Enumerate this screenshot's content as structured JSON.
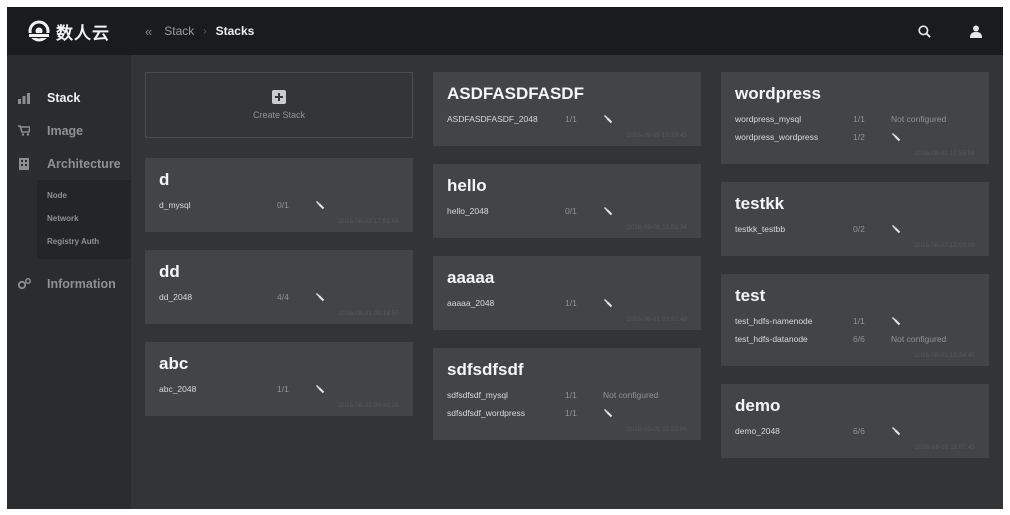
{
  "app": {
    "logo_text": "数人云"
  },
  "breadcrumb": {
    "back": "«",
    "items": [
      "Stack",
      "Stacks"
    ]
  },
  "sidebar": {
    "items": [
      {
        "label": "Stack",
        "icon": "chart-icon"
      },
      {
        "label": "Image",
        "icon": "cart-icon"
      },
      {
        "label": "Architecture",
        "icon": "building-icon"
      }
    ],
    "sub_items": [
      "Node",
      "Network",
      "Registry Auth"
    ],
    "info": {
      "label": "Information",
      "icon": "gears-icon"
    }
  },
  "create_stack": {
    "label": "Create Stack"
  },
  "columns": [
    [
      {
        "title": "d",
        "services": [
          {
            "name": "d_mysql",
            "count": "0/1",
            "status": ""
          }
        ],
        "timestamp": "2016-08-02 17:51:56"
      },
      {
        "title": "dd",
        "services": [
          {
            "name": "dd_2048",
            "count": "4/4",
            "status": ""
          }
        ],
        "timestamp": "2016-08-31 09:18:55"
      },
      {
        "title": "abc",
        "services": [
          {
            "name": "abc_2048",
            "count": "1/1",
            "status": ""
          }
        ],
        "timestamp": "2016-08-31 09:40:26"
      }
    ],
    [
      {
        "title": "ASDFASDFASDF",
        "services": [
          {
            "name": "ASDFASDFASDF_2048",
            "count": "1/1",
            "status": ""
          }
        ],
        "timestamp": "2016-09-05 13:23:45"
      },
      {
        "title": "hello",
        "services": [
          {
            "name": "hello_2048",
            "count": "0/1",
            "status": ""
          }
        ],
        "timestamp": "2016-09-01 11:01:34"
      },
      {
        "title": "aaaaa",
        "services": [
          {
            "name": "aaaaa_2048",
            "count": "1/1",
            "status": ""
          }
        ],
        "timestamp": "2016-08-31 09:51:48"
      },
      {
        "title": "sdfsdfsdf",
        "services": [
          {
            "name": "sdfsdfsdf_mysql",
            "count": "1/1",
            "status": "Not configured"
          },
          {
            "name": "sdfsdfsdf_wordpress",
            "count": "1/1",
            "status": ""
          }
        ],
        "timestamp": "2016-09-01 11:23:06"
      }
    ],
    [
      {
        "title": "wordpress",
        "services": [
          {
            "name": "wordpress_mysql",
            "count": "1/1",
            "status": "Not configured"
          },
          {
            "name": "wordpress_wordpress",
            "count": "1/2",
            "status": ""
          }
        ],
        "timestamp": "2016-08-02 17:55:58"
      },
      {
        "title": "testkk",
        "services": [
          {
            "name": "testkk_testbb",
            "count": "0/2",
            "status": ""
          }
        ],
        "timestamp": "2016-08-07 12:09:09"
      },
      {
        "title": "test",
        "services": [
          {
            "name": "test_hdfs-namenode",
            "count": "1/1",
            "status": ""
          },
          {
            "name": "test_hdfs-datanode",
            "count": "6/6",
            "status": "Not configured"
          }
        ],
        "timestamp": "2016-08-01 13:34:45"
      },
      {
        "title": "demo",
        "services": [
          {
            "name": "demo_2048",
            "count": "6/6",
            "status": ""
          }
        ],
        "timestamp": "2016-08-15 11:07:45"
      }
    ]
  ],
  "colors": {
    "topbar": "#1a1b1c",
    "sidebar": "#2a2c2e",
    "content": "#323436",
    "card": "#424446"
  }
}
